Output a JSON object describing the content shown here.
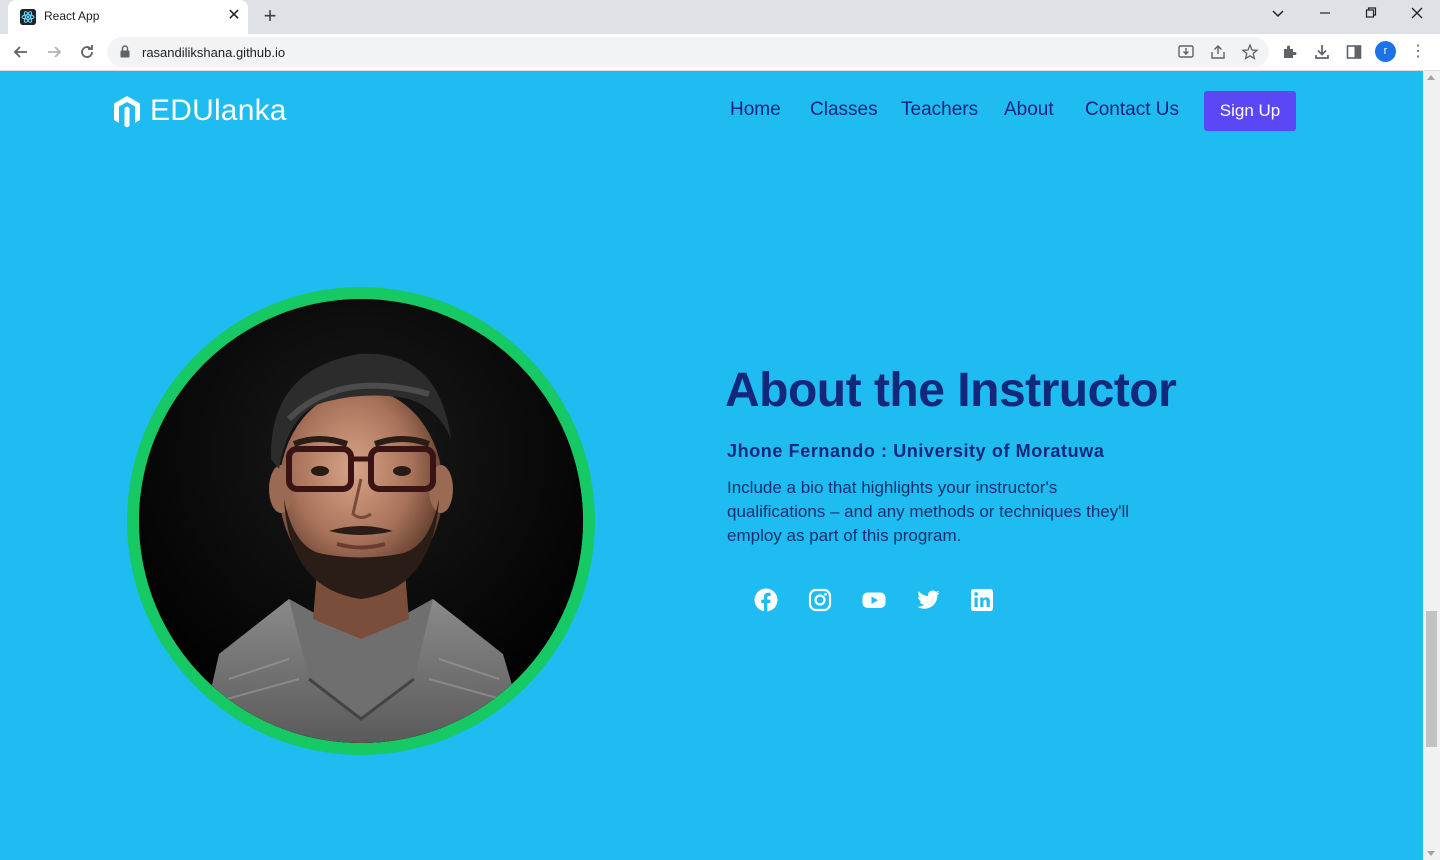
{
  "browser": {
    "tab_title": "React App",
    "url": "rasandilikshana.github.io",
    "profile_initial": "r"
  },
  "site": {
    "logo_text": "EDUlanka",
    "nav": [
      "Home",
      "Classes",
      "Teachers",
      "About",
      "Contact Us"
    ],
    "signup_label": "Sign Up",
    "colors": {
      "background": "#1ebcf0",
      "heading": "#13287a",
      "button": "#5b47f5",
      "photo_ring": "#17c964"
    }
  },
  "about": {
    "title": "About the Instructor",
    "instructor": "Jhone Fernando : University of Moratuwa",
    "bio": "Include a bio that highlights your instructor's qualifications – and any methods or techniques they'll employ as part of this program.",
    "social_icons": [
      "facebook-icon",
      "instagram-icon",
      "youtube-icon",
      "twitter-icon",
      "linkedin-icon"
    ]
  }
}
